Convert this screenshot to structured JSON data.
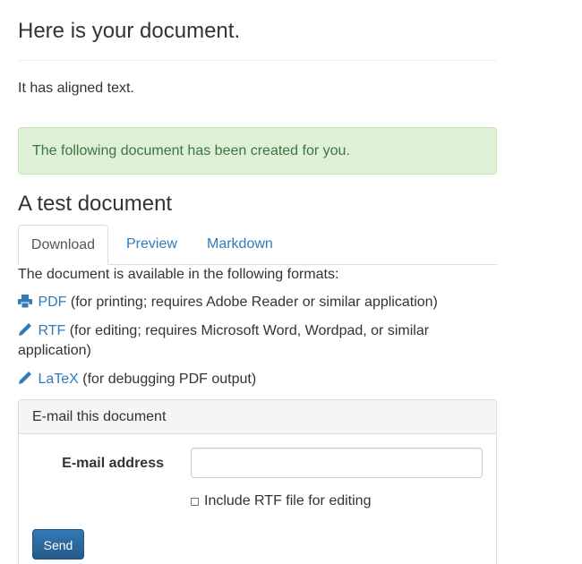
{
  "page": {
    "title": "Here is your document.",
    "intro": "It has aligned text."
  },
  "alert": {
    "text": "The following document has been created for you."
  },
  "document": {
    "title": "A test document"
  },
  "tabs": [
    {
      "label": "Download",
      "active": true
    },
    {
      "label": "Preview",
      "active": false
    },
    {
      "label": "Markdown",
      "active": false
    }
  ],
  "download": {
    "intro": "The document is available in the following formats:",
    "formats": [
      {
        "icon": "print-icon",
        "link": "PDF",
        "desc": "(for printing; requires Adobe Reader or similar application)"
      },
      {
        "icon": "pencil-icon",
        "link": "RTF",
        "desc": "(for editing; requires Microsoft Word, Wordpad, or similar application)"
      },
      {
        "icon": "pencil-icon",
        "link": "LaTeX",
        "desc": "(for debugging PDF output)"
      }
    ]
  },
  "email_panel": {
    "heading": "E-mail this document",
    "email_label": "E-mail address",
    "email_value": "",
    "checkbox_label": "Include RTF file for editing",
    "checkbox_checked": false,
    "send_label": "Send"
  },
  "colors": {
    "link": "#337ab7",
    "alert_bg": "#dff0d8",
    "alert_text": "#3c763d",
    "button": "#337ab7"
  }
}
